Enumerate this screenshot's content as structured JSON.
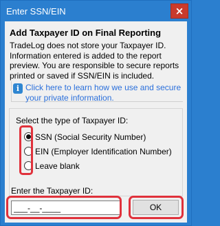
{
  "window": {
    "title": "Enter SSN/EIN",
    "close_label": "×"
  },
  "content": {
    "heading": "Add Taxpayer ID on Final Reporting",
    "info_text": "TradeLog does not store your Taxpayer ID. Information entered is added to the report preview. You are responsible to secure reports printed or saved if SSN/EIN is included.",
    "help_icon": "info-icon",
    "help_link": "Click here to learn how we use and secure your private information."
  },
  "taxpayer_type": {
    "label": "Select the type of Taxpayer ID:",
    "options": [
      {
        "label": "SSN (Social Security Number)",
        "checked": true
      },
      {
        "label": "EIN (Employer Identification Number)",
        "checked": false
      },
      {
        "label": "Leave blank",
        "checked": false
      }
    ]
  },
  "taxpayer_id": {
    "label": "Enter the Taxpayer ID:",
    "value": "___-__-____"
  },
  "ok_button": {
    "label": "OK"
  },
  "colors": {
    "title_bar": "#2b7fcf",
    "close_button": "#c93a2c",
    "link": "#2a6fdb",
    "highlight": "#e0313b"
  }
}
